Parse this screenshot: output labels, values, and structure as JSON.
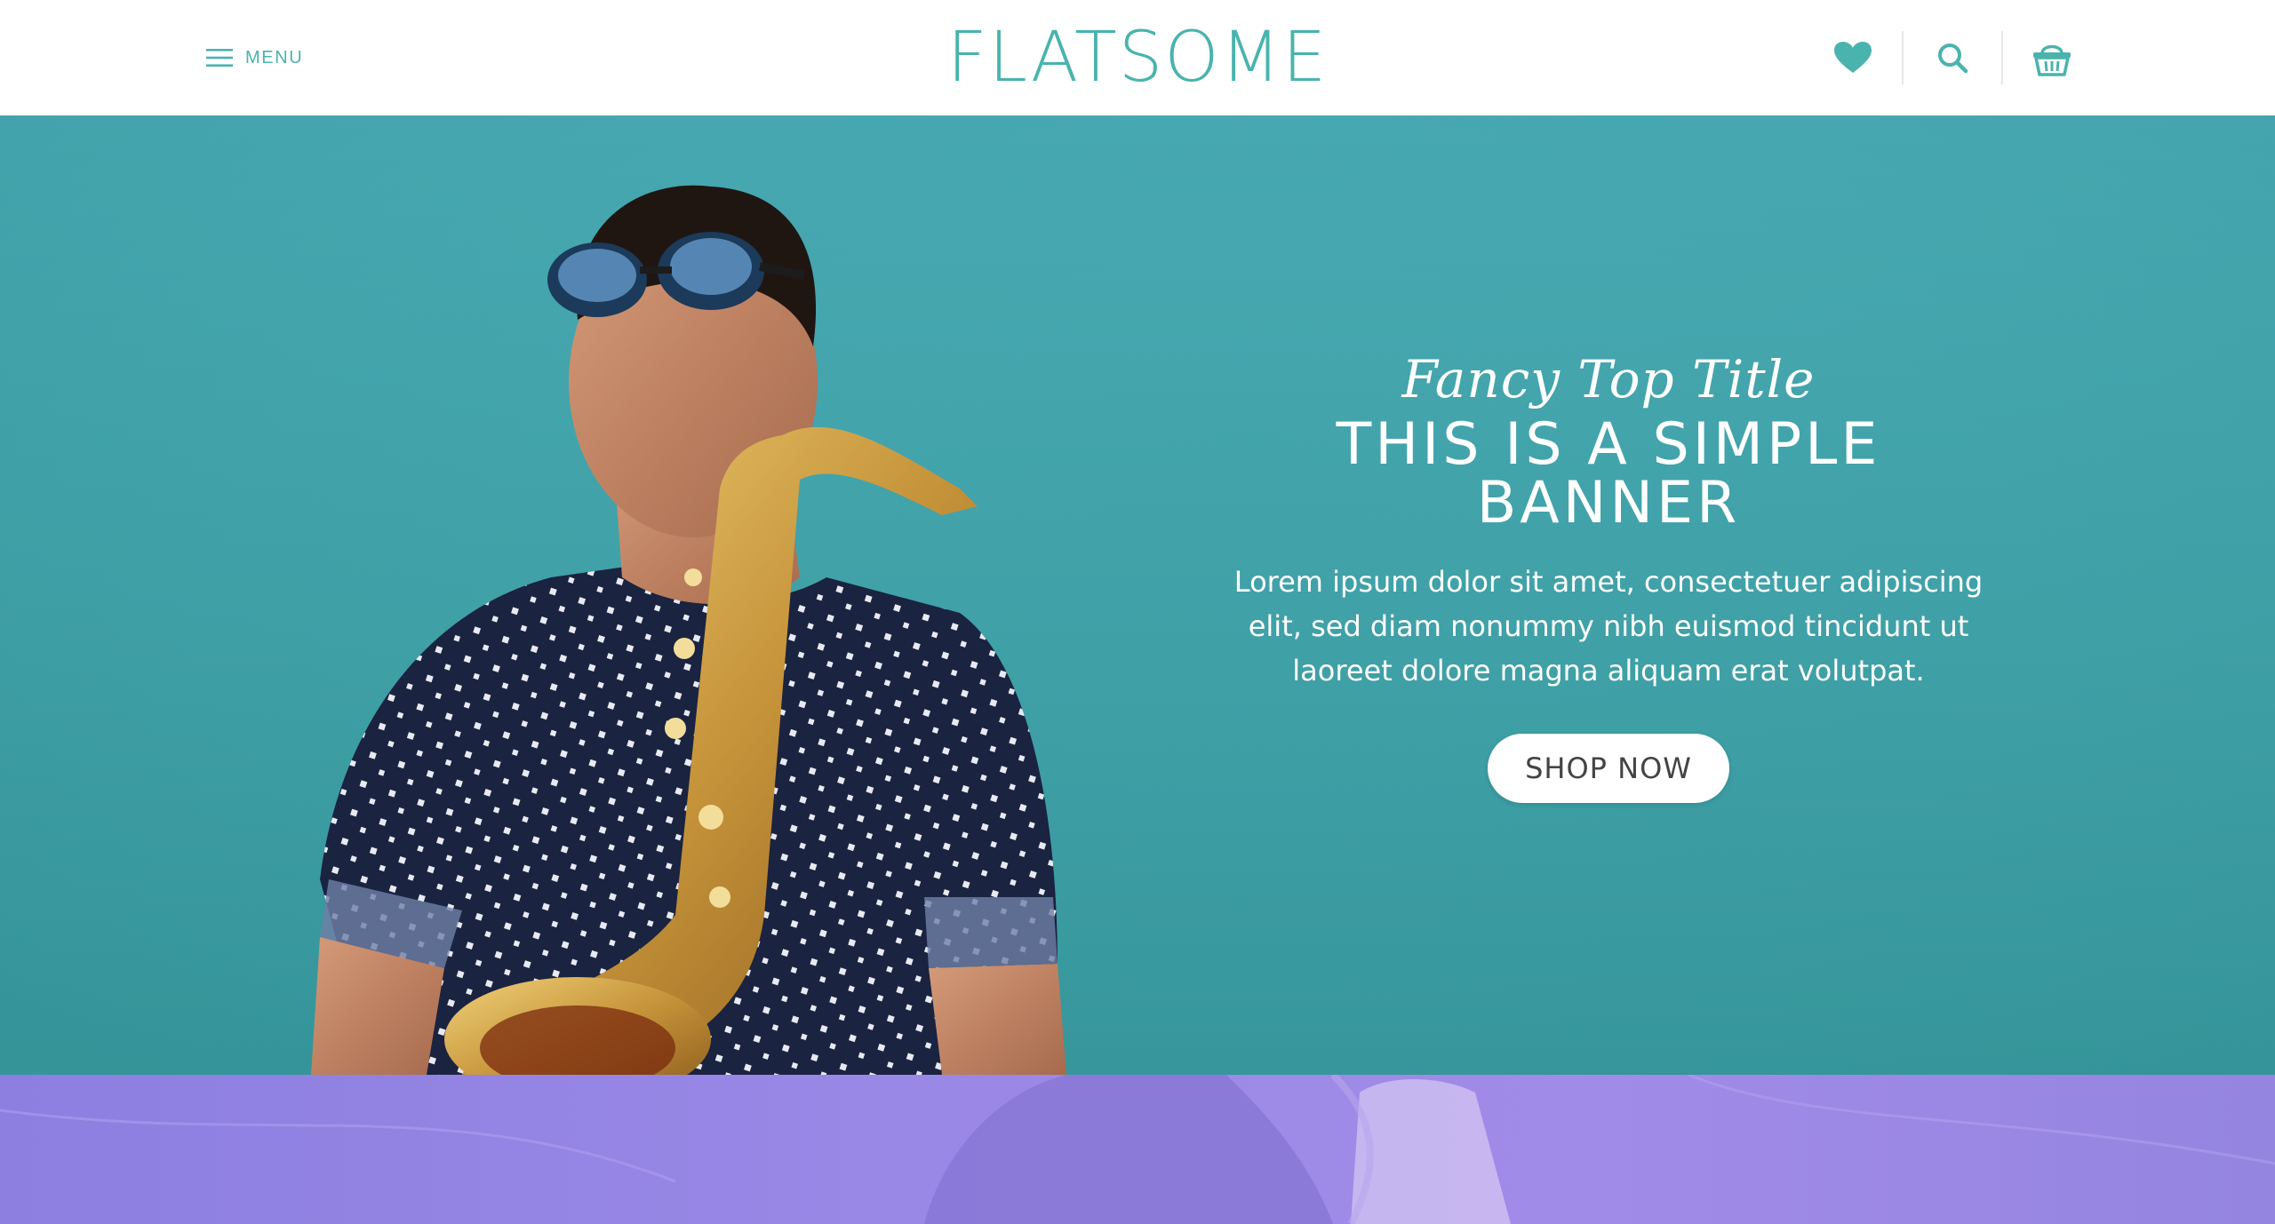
{
  "header": {
    "menu_label": "MENU",
    "logo_text": "FLATSOME",
    "icons": [
      "heart-icon",
      "search-icon",
      "basket-icon"
    ],
    "accent_color": "#4ab3ad"
  },
  "hero": {
    "fancy_title": "Fancy Top Title",
    "title": "THIS IS A SIMPLE BANNER",
    "text": "Lorem ipsum dolor sit amet, consectetuer adipiscing elit, sed diam nonummy nibh euismod tincidunt ut laoreet dolore magna aliquam erat volutpat.",
    "button_label": "SHOP NOW",
    "background_color": "#44a5ad"
  },
  "section2": {
    "background_color": "#9a88e6"
  }
}
